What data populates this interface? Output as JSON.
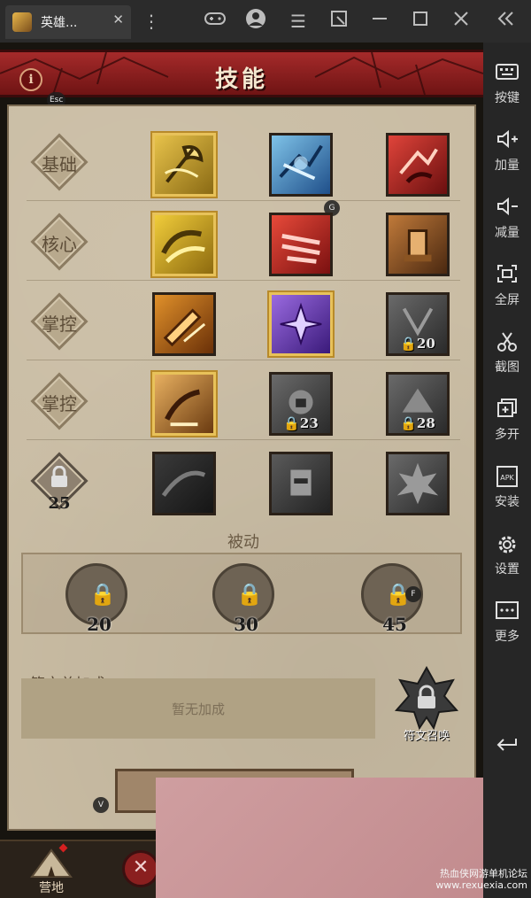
{
  "window": {
    "tab_title": "英雄...",
    "tab_close": "✕"
  },
  "sidebar": {
    "items": [
      {
        "label": "按键",
        "icon": "keyboard-icon"
      },
      {
        "label": "加量",
        "icon": "volume-up-icon"
      },
      {
        "label": "减量",
        "icon": "volume-down-icon"
      },
      {
        "label": "全屏",
        "icon": "fullscreen-icon"
      },
      {
        "label": "截图",
        "icon": "scissors-icon"
      },
      {
        "label": "多开",
        "icon": "multi-open-icon"
      },
      {
        "label": "安装",
        "icon": "apk-install-icon"
      },
      {
        "label": "设置",
        "icon": "gear-icon"
      },
      {
        "label": "更多",
        "icon": "more-icon"
      }
    ],
    "apk_text": "APK"
  },
  "game": {
    "title": "技能",
    "info_label": "i",
    "esc_hint": "Esc",
    "g_hint": "G",
    "f_hint": "F",
    "v_hint": "V",
    "rows": [
      {
        "label": "基础"
      },
      {
        "label": "核心"
      },
      {
        "label": "掌控"
      },
      {
        "label": "掌控"
      },
      {
        "label": "",
        "lock_level": "25"
      }
    ],
    "locked_levels": {
      "row3_col3": "20",
      "row4_col2": "23",
      "row4_col3": "28"
    },
    "passive": {
      "label": "被动",
      "slots": [
        {
          "level": "20"
        },
        {
          "level": "30"
        },
        {
          "level": "45"
        }
      ]
    },
    "runes": {
      "title": "符文总加成",
      "empty_text": "暂无加成",
      "summon_label": "符文召唤"
    },
    "bottom": {
      "camp_label": "营地"
    }
  },
  "watermark": {
    "line1": "热血侠网游单机论坛",
    "line2": "www.rexuexia.com"
  },
  "colors": {
    "banner_red": "#a52a2a",
    "panel_parchment": "#c9bca3",
    "selected_border": "#e8c25a"
  }
}
